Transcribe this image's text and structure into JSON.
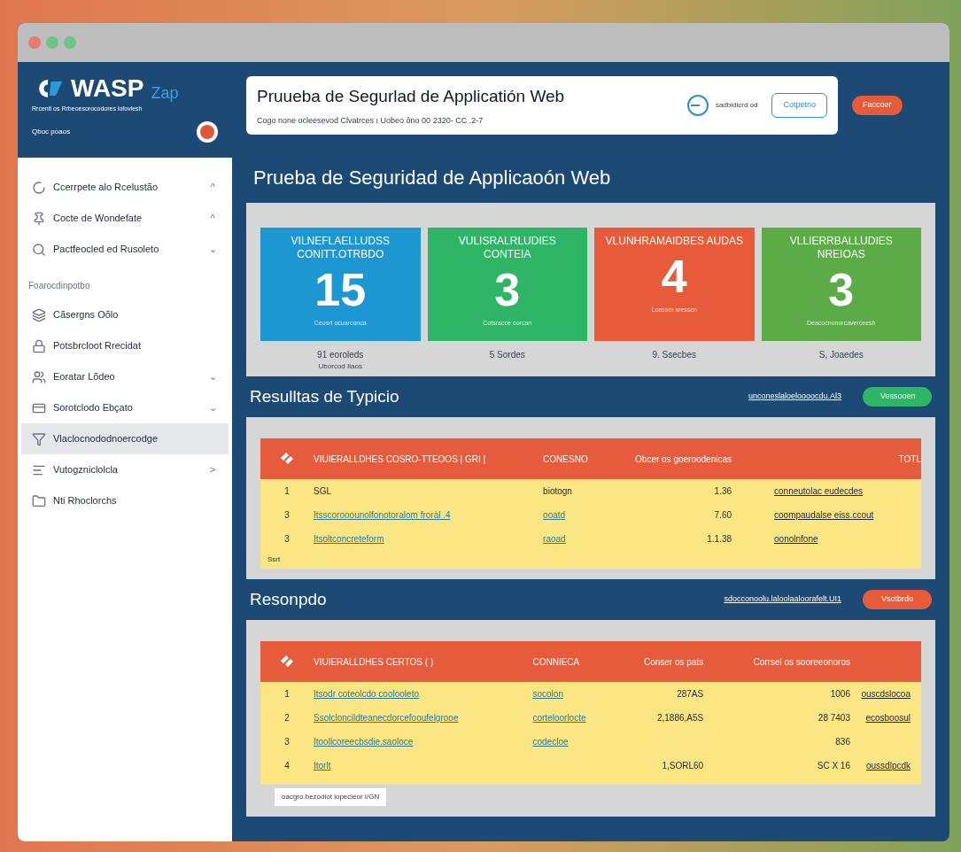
{
  "sidebar": {
    "logo": "WASP",
    "logo_suffix": "Zap",
    "tagline": "Rrcentl os Rrbeoesorocodores lofovlesh",
    "subtitle": "Qboc poaos",
    "items": [
      {
        "kind": "item",
        "label": "Ccerrpete alo Rcelustão",
        "chevron": "^",
        "selected": false
      },
      {
        "kind": "item",
        "label": "Cocte de Wondefate",
        "chevron": "^",
        "selected": false
      },
      {
        "kind": "item",
        "label": "Pactfeocled ed Rusoleto",
        "chevron": "⌄",
        "selected": false
      },
      {
        "kind": "heading",
        "label": "Foarocdinpotbo"
      },
      {
        "kind": "item",
        "label": "Cãsergns Oõlo",
        "selected": false
      },
      {
        "kind": "item",
        "label": "Potsbrcloot Rrecidat",
        "selected": false
      },
      {
        "kind": "item",
        "label": "Eoratar Lõdeo",
        "chevron": "⌄",
        "selected": false
      },
      {
        "kind": "item",
        "label": "Sorotclodo Ebçato",
        "chevron": "⌄",
        "selected": false
      },
      {
        "kind": "item",
        "label": "Vlaclocnododnoercodge",
        "selected": true
      },
      {
        "kind": "item",
        "label": "Vutogzniclolcla",
        "chevron": ">",
        "selected": false
      },
      {
        "kind": "item",
        "label": "Nti Rhoclorchs",
        "selected": false
      }
    ]
  },
  "header": {
    "title": "Pruueba de Segurlad de Applicatión Web",
    "subtitle": "Cogo none ocleesevod Clvatrces ı  Uobeo ôno 00 2320- CC .2-7",
    "toggle_label": "sadbidicrd od",
    "toggle_on": false,
    "outline_button": "Cotpetno",
    "action_button": "Faccoer"
  },
  "page_title": "Prueba de Seguridad de Applicaoón Web",
  "stats": [
    {
      "title": "VILNEFLAELLUDSS CONITT.OTRBDO",
      "count": "15",
      "footnote": "Ceosrt ocuarconca",
      "captions": [
        "91 eoroleds",
        "Uborcod Ilaos"
      ],
      "color": "#1c97d1"
    },
    {
      "title": "VULISRALRLUDIES CONTEIA",
      "count": "3",
      "footnote": "Cotsracce oorcan",
      "captions": [
        "5 Sordes"
      ],
      "color": "#2eb566"
    },
    {
      "title": "VLUNHRAMAIDBES AUDAS",
      "count": "4",
      "footnote": "Lcecorn sresscn",
      "captions": [
        "9. Ssecbes"
      ],
      "color": "#e75b3b"
    },
    {
      "title": "VLLIERRBALLUDIES NREIOAS",
      "count": "3",
      "footnote": "Deacocnonorcaverceesh",
      "captions": [
        "S, Joaedes"
      ],
      "color": "#5bab46"
    }
  ],
  "sections": [
    {
      "title": "Resulltas de Typicio",
      "link": "unconeslaloeloooocdu.Al3",
      "button": {
        "label": "Vessooen",
        "color": "#2eb566"
      },
      "table": {
        "columns": [
          "VIUIERALLDHES COSRO-TTEOOS | GRI |",
          "CONESNO",
          "Obcer os goeroodenicas",
          "TOTL"
        ],
        "rows": [
          {
            "number": "1",
            "name": {
              "text": "SGL",
              "link": false
            },
            "category": {
              "text": "biotogn",
              "link": false
            },
            "value": "1.36",
            "extra": null,
            "action": "conneutolac eudecdes"
          },
          {
            "number": "3",
            "name": {
              "text": "Itsscorooounolfonotoralom froràl .4",
              "link": true
            },
            "category": {
              "text": "ooatd",
              "link": true
            },
            "value": "7.60",
            "extra": null,
            "action": "coompaudalse eiss.ccout"
          },
          {
            "number": "3",
            "name": {
              "text": "Itsoltconcreteform",
              "link": true
            },
            "category": {
              "text": "raoad",
              "link": true
            },
            "value": "1.1.38",
            "extra": null,
            "action": "oonolnfone"
          }
        ],
        "footer": "Ssrt",
        "footer_boxed": false
      }
    },
    {
      "title": "Resonpdo",
      "link": "sdocconoolu.laloolaaloorafelt.UI1",
      "button": {
        "label": "Vsotbrdo",
        "color": "#e75b3b"
      },
      "table": {
        "columns": [
          "VIUIERALLDHES CERTOS ( )",
          "CONNIECA",
          "Conser os pats",
          "Corrsel os sooreeonoros"
        ],
        "rows": [
          {
            "number": "1",
            "name": {
              "text": "Itsodr coteolcdo coolooleto",
              "link": true
            },
            "category": {
              "text": "socolon",
              "link": true
            },
            "value": "287AS",
            "extra": "1006",
            "action": "ouscdslocoa"
          },
          {
            "number": "2",
            "name": {
              "text": "Ssolcloncildteanecdorcefooufelgrooe",
              "link": true
            },
            "category": {
              "text": "corteloorlocte",
              "link": true
            },
            "value": "2,1886,A5S",
            "extra": "28 7403",
            "action": "ecosboosul"
          },
          {
            "number": "3",
            "name": {
              "text": "Itoollcoreecbsdie.saoloce",
              "link": true
            },
            "category": {
              "text": "codecloe",
              "link": true
            },
            "value": null,
            "extra": "836",
            "action": null
          },
          {
            "number": "4",
            "name": {
              "text": "Itorlt",
              "link": true
            },
            "category": null,
            "value": "1,SORL60",
            "extra": "SC X 16",
            "action": "oussdlpcdk"
          }
        ],
        "footer": "oacgro.bezodiot iopecieor I/GN",
        "footer_boxed": true
      }
    }
  ]
}
